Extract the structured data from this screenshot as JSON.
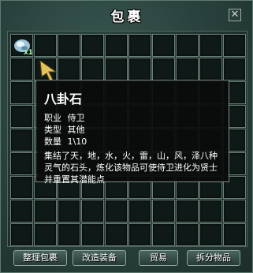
{
  "window": {
    "title": "包裹",
    "close_glyph": "✕"
  },
  "grid": {
    "columns": 10,
    "rows": 9
  },
  "item": {
    "quantity": "x1",
    "icon": "bagua-stone-icon"
  },
  "tooltip": {
    "name": "八卦石",
    "job_label": "职业",
    "job_value": "侍卫",
    "type_label": "类型",
    "type_value": "其他",
    "qty_label": "数量",
    "qty_value": "1\\10",
    "description": "集结了天，地，水，火，雷，山，风，泽八种灵气的石头，炼化该物品可使侍卫进化为贤士并重置其潜能点"
  },
  "buttons": {
    "sort": "整理包裹",
    "upgrade": "改造装备",
    "trade": "贸易",
    "split": "拆分物品"
  }
}
